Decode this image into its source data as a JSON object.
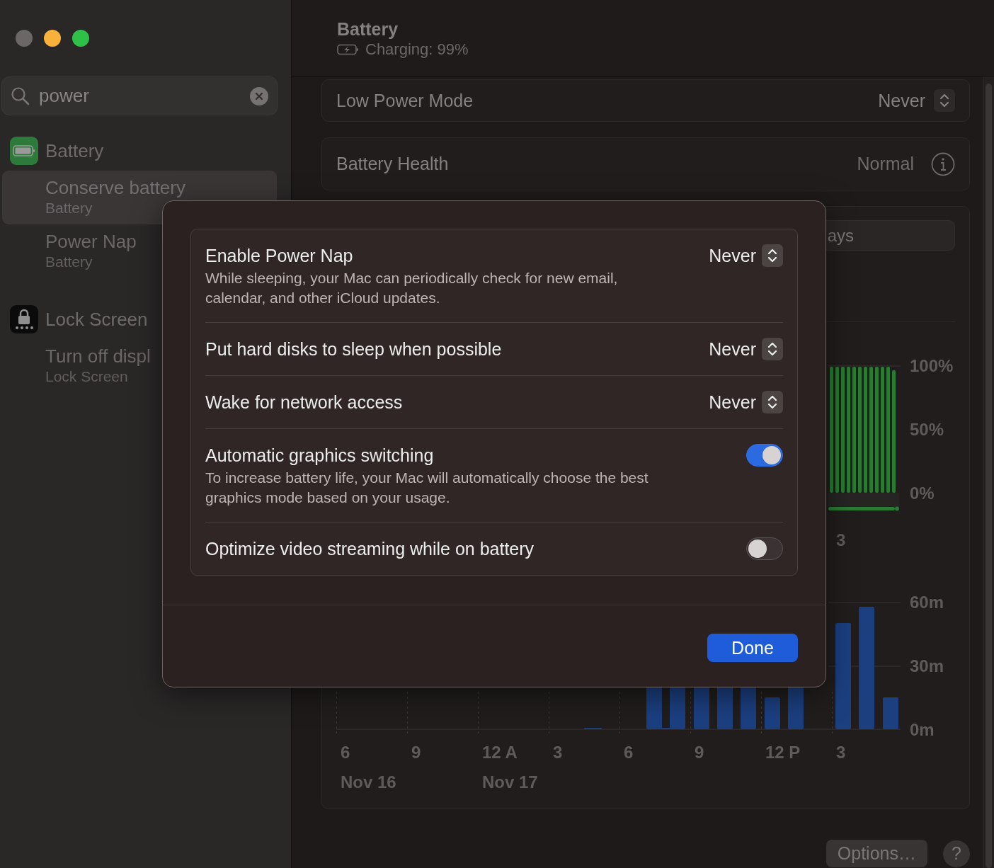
{
  "sidebar": {
    "search": {
      "value": "power"
    },
    "groups": [
      {
        "kind": "battery",
        "title": "Battery",
        "items": [
          {
            "title": "Conserve battery",
            "subtitle": "Battery",
            "selected": true
          },
          {
            "title": "Power Nap",
            "subtitle": "Battery",
            "selected": false
          }
        ]
      },
      {
        "kind": "lock",
        "title": "Lock Screen",
        "items": [
          {
            "title": "Turn off displ",
            "subtitle": "Lock Screen",
            "selected": false
          }
        ]
      }
    ]
  },
  "header": {
    "title": "Battery",
    "subtitle": "Charging: 99%"
  },
  "settings": [
    {
      "kind": "popup",
      "label": "Low Power Mode",
      "value": "Never"
    },
    {
      "kind": "info",
      "label": "Battery Health",
      "value": "Normal"
    }
  ],
  "usage": {
    "segment_text": "ays",
    "level_axis": [
      "100%",
      "50%",
      "0%"
    ],
    "level_hour": "3",
    "usage_axis": [
      "60m",
      "30m",
      "0m"
    ],
    "hours": [
      "6",
      "9",
      "12 A",
      "3",
      "6",
      "9",
      "12 P",
      "3"
    ],
    "dates": [
      "Nov 16",
      "Nov 17"
    ]
  },
  "footer": {
    "options": "Options…",
    "help": "?"
  },
  "dialog": {
    "rows": [
      {
        "kind": "popup",
        "title": "Enable Power Nap",
        "description": "While sleeping, your Mac can periodically check for new email, calendar, and other iCloud updates.",
        "value": "Never"
      },
      {
        "kind": "popup",
        "title": "Put hard disks to sleep when possible",
        "value": "Never"
      },
      {
        "kind": "popup",
        "title": "Wake for network access",
        "value": "Never"
      },
      {
        "kind": "toggle",
        "title": "Automatic graphics switching",
        "description": "To increase battery life, your Mac will automatically choose the best graphics mode based on your usage.",
        "on": true
      },
      {
        "kind": "toggle",
        "title": "Optimize video streaming while on battery",
        "on": false
      }
    ],
    "button": "Done"
  }
}
